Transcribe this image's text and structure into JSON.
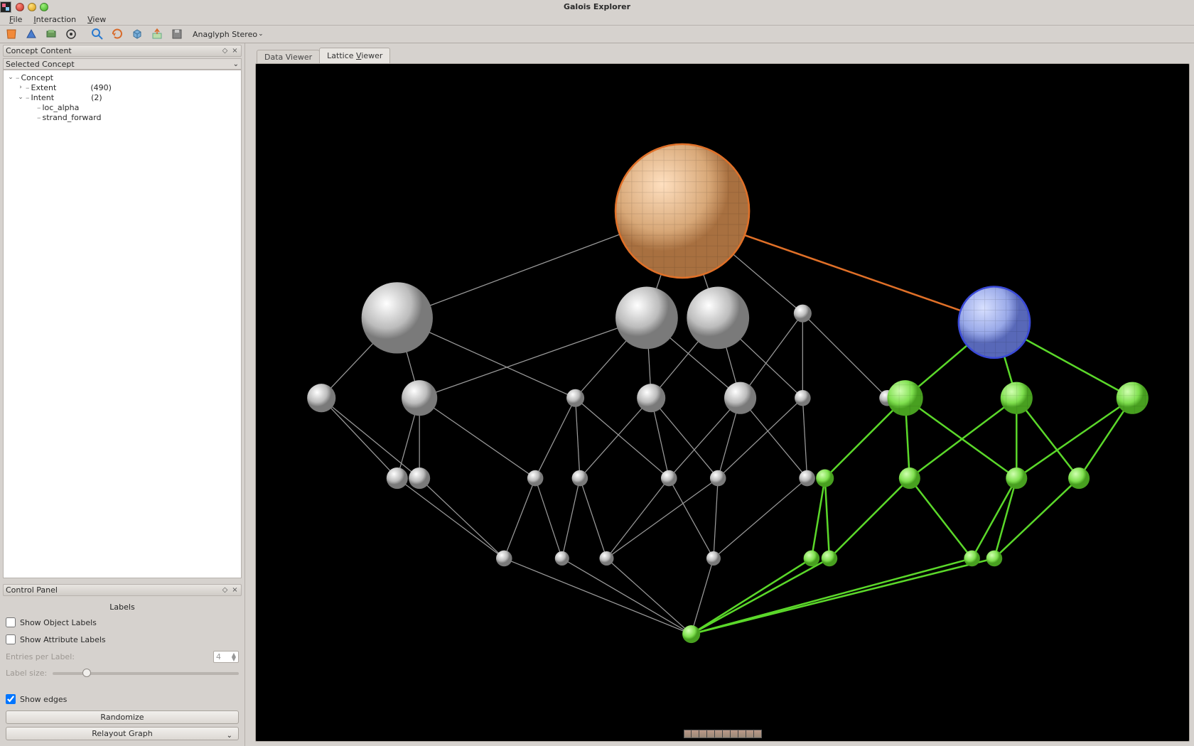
{
  "app": {
    "title": "Galois Explorer"
  },
  "menu": {
    "file": "File",
    "interaction": "Interaction",
    "view": "View"
  },
  "toolbar": {
    "stereo_label": "Anaglyph Stereo"
  },
  "panel": {
    "concept_content_title": "Concept Content",
    "selected_concept_title": "Selected Concept",
    "tree": {
      "concept": "Concept",
      "extent": "Extent",
      "extent_count": "(490)",
      "intent": "Intent",
      "intent_count": "(2)",
      "leaf1": "loc_alpha",
      "leaf2": "strand_forward"
    }
  },
  "control": {
    "title": "Control Panel",
    "labels_header": "Labels",
    "show_object": "Show Object Labels",
    "show_attr": "Show Attribute Labels",
    "entries_label": "Entries per Label:",
    "entries_value": "4",
    "label_size": "Label size:",
    "show_edges": "Show edges",
    "randomize": "Randomize",
    "relayout": "Relayout Graph"
  },
  "tabs": {
    "data": "Data Viewer",
    "lattice": "Lattice Viewer"
  },
  "colors": {
    "top_node": "#d88a4a",
    "edge_selected": "#d86a2a",
    "blue_node": "#4a5fd8",
    "green": "#5bd82a",
    "grey": "#cfcfcf",
    "edge_grey": "#9a9a9a"
  }
}
